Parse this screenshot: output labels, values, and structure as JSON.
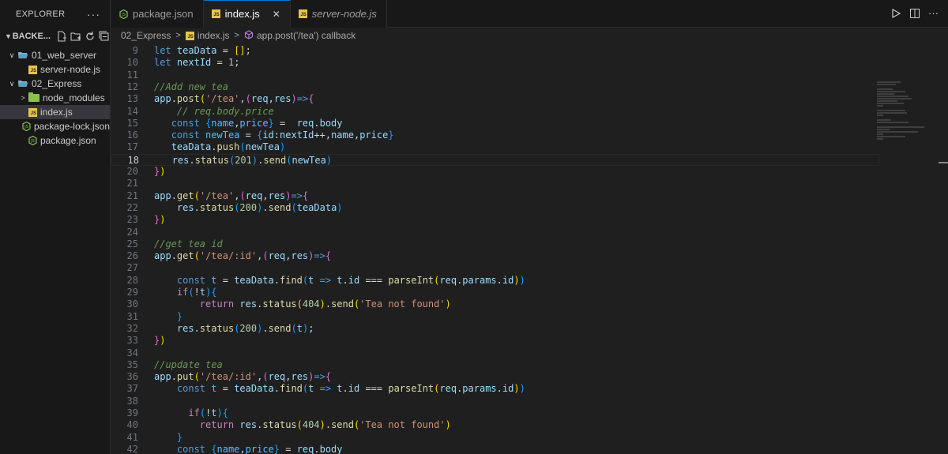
{
  "sidebar": {
    "title": "EXPLORER",
    "root": "BACKE...",
    "items": [
      {
        "label": "01_web_server",
        "kind": "folder-open",
        "indent": 1
      },
      {
        "label": "server-node.js",
        "kind": "js",
        "indent": 2
      },
      {
        "label": "02_Express",
        "kind": "folder-open",
        "indent": 1
      },
      {
        "label": "node_modules",
        "kind": "folder-green",
        "indent": 2
      },
      {
        "label": "index.js",
        "kind": "js",
        "indent": 2,
        "active": true
      },
      {
        "label": "package-lock.json",
        "kind": "json",
        "indent": 2
      },
      {
        "label": "package.json",
        "kind": "json",
        "indent": 2
      }
    ]
  },
  "tabs": [
    {
      "label": "package.json",
      "icon": "json-icon"
    },
    {
      "label": "index.js",
      "icon": "js-icon",
      "active": true
    },
    {
      "label": "server-node.js",
      "icon": "js-icon",
      "italic": true
    }
  ],
  "breadcrumb": [
    "02_Express",
    "index.js",
    "app.post('/tea') callback"
  ],
  "editor": {
    "current_line": 18,
    "lines": [
      {
        "n": 9,
        "t": [
          [
            "kw",
            "let"
          ],
          [
            "pn",
            " "
          ],
          [
            "vr",
            "teaData"
          ],
          [
            "pn",
            " = "
          ],
          [
            "br1",
            "[]"
          ],
          [
            "pn",
            ";"
          ]
        ]
      },
      {
        "n": 10,
        "t": [
          [
            "kw",
            "let"
          ],
          [
            "pn",
            " "
          ],
          [
            "vr",
            "nextId"
          ],
          [
            "pn",
            " = "
          ],
          [
            "nm",
            "1"
          ],
          [
            "pn",
            ";"
          ]
        ]
      },
      {
        "n": 11,
        "t": []
      },
      {
        "n": 12,
        "t": [
          [
            "cm",
            "//Add new tea"
          ]
        ]
      },
      {
        "n": 13,
        "t": [
          [
            "vr",
            "app"
          ],
          [
            "pn",
            "."
          ],
          [
            "fn",
            "post"
          ],
          [
            "br1",
            "("
          ],
          [
            "st",
            "'/tea'"
          ],
          [
            "pn",
            ","
          ],
          [
            "br2",
            "("
          ],
          [
            "vr",
            "req"
          ],
          [
            "pn",
            ","
          ],
          [
            "vr",
            "res"
          ],
          [
            "br2",
            ")"
          ],
          [
            "kw",
            "=>"
          ],
          [
            "br2",
            "{"
          ]
        ]
      },
      {
        "n": 14,
        "t": [
          [
            "pn",
            "    "
          ],
          [
            "cm",
            "// req.body.price"
          ]
        ]
      },
      {
        "n": 15,
        "t": [
          [
            "pn",
            "   "
          ],
          [
            "kw",
            "const"
          ],
          [
            "pn",
            " "
          ],
          [
            "br3",
            "{"
          ],
          [
            "cn",
            "name"
          ],
          [
            "pn",
            ","
          ],
          [
            "cn",
            "price"
          ],
          [
            "br3",
            "}"
          ],
          [
            "pn",
            " =  "
          ],
          [
            "vr",
            "req"
          ],
          [
            "pn",
            "."
          ],
          [
            "vr",
            "body"
          ]
        ]
      },
      {
        "n": 16,
        "t": [
          [
            "pn",
            "   "
          ],
          [
            "kw",
            "const"
          ],
          [
            "pn",
            " "
          ],
          [
            "cn",
            "newTea"
          ],
          [
            "pn",
            " = "
          ],
          [
            "br3",
            "{"
          ],
          [
            "vr",
            "id"
          ],
          [
            "pn",
            ":"
          ],
          [
            "vr",
            "nextId"
          ],
          [
            "pn",
            "++,"
          ],
          [
            "vr",
            "name"
          ],
          [
            "pn",
            ","
          ],
          [
            "vr",
            "price"
          ],
          [
            "br3",
            "}"
          ]
        ]
      },
      {
        "n": 17,
        "t": [
          [
            "pn",
            "   "
          ],
          [
            "vr",
            "teaData"
          ],
          [
            "pn",
            "."
          ],
          [
            "fn",
            "push"
          ],
          [
            "br3",
            "("
          ],
          [
            "vr",
            "newTea"
          ],
          [
            "br3",
            ")"
          ]
        ]
      },
      {
        "n": 18,
        "t": [
          [
            "pn",
            "   "
          ],
          [
            "vr",
            "res"
          ],
          [
            "pn",
            "."
          ],
          [
            "fn",
            "status"
          ],
          [
            "br3",
            "("
          ],
          [
            "nm",
            "201"
          ],
          [
            "br3",
            ")"
          ],
          [
            "pn",
            "."
          ],
          [
            "fn",
            "send"
          ],
          [
            "br3",
            "("
          ],
          [
            "vr",
            "newTea"
          ],
          [
            "br3",
            ")"
          ]
        ]
      },
      {
        "n": 20,
        "t": [
          [
            "br2",
            "}"
          ],
          [
            "br1",
            ")"
          ]
        ]
      },
      {
        "n": 21,
        "t": []
      },
      {
        "n": 21,
        "t": [
          [
            "vr",
            "app"
          ],
          [
            "pn",
            "."
          ],
          [
            "fn",
            "get"
          ],
          [
            "br1",
            "("
          ],
          [
            "st",
            "'/tea'"
          ],
          [
            "pn",
            ","
          ],
          [
            "br2",
            "("
          ],
          [
            "vr",
            "req"
          ],
          [
            "pn",
            ","
          ],
          [
            "vr",
            "res"
          ],
          [
            "br2",
            ")"
          ],
          [
            "kw",
            "=>"
          ],
          [
            "br2",
            "{"
          ]
        ]
      },
      {
        "n": 22,
        "t": [
          [
            "pn",
            "    "
          ],
          [
            "vr",
            "res"
          ],
          [
            "pn",
            "."
          ],
          [
            "fn",
            "status"
          ],
          [
            "br3",
            "("
          ],
          [
            "nm",
            "200"
          ],
          [
            "br3",
            ")"
          ],
          [
            "pn",
            "."
          ],
          [
            "fn",
            "send"
          ],
          [
            "br3",
            "("
          ],
          [
            "vr",
            "teaData"
          ],
          [
            "br3",
            ")"
          ]
        ]
      },
      {
        "n": 23,
        "t": [
          [
            "br2",
            "}"
          ],
          [
            "br1",
            ")"
          ]
        ]
      },
      {
        "n": 24,
        "t": []
      },
      {
        "n": 25,
        "t": [
          [
            "cm",
            "//get tea id"
          ]
        ]
      },
      {
        "n": 26,
        "t": [
          [
            "vr",
            "app"
          ],
          [
            "pn",
            "."
          ],
          [
            "fn",
            "get"
          ],
          [
            "br1",
            "("
          ],
          [
            "st",
            "'/tea/:id'"
          ],
          [
            "pn",
            ","
          ],
          [
            "br2",
            "("
          ],
          [
            "vr",
            "req"
          ],
          [
            "pn",
            ","
          ],
          [
            "vr",
            "res"
          ],
          [
            "br2",
            ")"
          ],
          [
            "kw",
            "=>"
          ],
          [
            "br2",
            "{"
          ]
        ]
      },
      {
        "n": 27,
        "t": []
      },
      {
        "n": 28,
        "t": [
          [
            "pn",
            "    "
          ],
          [
            "kw",
            "const"
          ],
          [
            "pn",
            " "
          ],
          [
            "cn",
            "t"
          ],
          [
            "pn",
            " = "
          ],
          [
            "vr",
            "teaData"
          ],
          [
            "pn",
            "."
          ],
          [
            "fn",
            "find"
          ],
          [
            "br3",
            "("
          ],
          [
            "vr",
            "t"
          ],
          [
            "pn",
            " "
          ],
          [
            "kw",
            "=>"
          ],
          [
            "pn",
            " "
          ],
          [
            "vr",
            "t"
          ],
          [
            "pn",
            "."
          ],
          [
            "vr",
            "id"
          ],
          [
            "pn",
            " === "
          ],
          [
            "fn",
            "parseInt"
          ],
          [
            "br1",
            "("
          ],
          [
            "vr",
            "req"
          ],
          [
            "pn",
            "."
          ],
          [
            "vr",
            "params"
          ],
          [
            "pn",
            "."
          ],
          [
            "vr",
            "id"
          ],
          [
            "br1",
            ")"
          ],
          [
            "br3",
            ")"
          ]
        ]
      },
      {
        "n": 29,
        "t": [
          [
            "pn",
            "    "
          ],
          [
            "kw2",
            "if"
          ],
          [
            "br3",
            "("
          ],
          [
            "pn",
            "!"
          ],
          [
            "vr",
            "t"
          ],
          [
            "br3",
            ")"
          ],
          [
            "br3",
            "{"
          ]
        ]
      },
      {
        "n": 30,
        "t": [
          [
            "pn",
            "        "
          ],
          [
            "kw2",
            "return"
          ],
          [
            "pn",
            " "
          ],
          [
            "vr",
            "res"
          ],
          [
            "pn",
            "."
          ],
          [
            "fn",
            "status"
          ],
          [
            "br1",
            "("
          ],
          [
            "nm",
            "404"
          ],
          [
            "br1",
            ")"
          ],
          [
            "pn",
            "."
          ],
          [
            "fn",
            "send"
          ],
          [
            "br1",
            "("
          ],
          [
            "st",
            "'Tea not found'"
          ],
          [
            "br1",
            ")"
          ]
        ]
      },
      {
        "n": 31,
        "t": [
          [
            "pn",
            "    "
          ],
          [
            "br3",
            "}"
          ]
        ]
      },
      {
        "n": 32,
        "t": [
          [
            "pn",
            "    "
          ],
          [
            "vr",
            "res"
          ],
          [
            "pn",
            "."
          ],
          [
            "fn",
            "status"
          ],
          [
            "br3",
            "("
          ],
          [
            "nm",
            "200"
          ],
          [
            "br3",
            ")"
          ],
          [
            "pn",
            "."
          ],
          [
            "fn",
            "send"
          ],
          [
            "br3",
            "("
          ],
          [
            "vr",
            "t"
          ],
          [
            "br3",
            ")"
          ],
          [
            "pn",
            ";"
          ]
        ]
      },
      {
        "n": 33,
        "t": [
          [
            "br2",
            "}"
          ],
          [
            "br1",
            ")"
          ]
        ]
      },
      {
        "n": 34,
        "t": []
      },
      {
        "n": 35,
        "t": [
          [
            "cm",
            "//update tea"
          ]
        ]
      },
      {
        "n": 36,
        "t": [
          [
            "vr",
            "app"
          ],
          [
            "pn",
            "."
          ],
          [
            "fn",
            "put"
          ],
          [
            "br1",
            "("
          ],
          [
            "st",
            "'/tea/:id'"
          ],
          [
            "pn",
            ","
          ],
          [
            "br2",
            "("
          ],
          [
            "vr",
            "req"
          ],
          [
            "pn",
            ","
          ],
          [
            "vr",
            "res"
          ],
          [
            "br2",
            ")"
          ],
          [
            "kw",
            "=>"
          ],
          [
            "br2",
            "{"
          ]
        ]
      },
      {
        "n": 37,
        "t": [
          [
            "pn",
            "    "
          ],
          [
            "kw",
            "const"
          ],
          [
            "pn",
            " "
          ],
          [
            "cn",
            "t"
          ],
          [
            "pn",
            " = "
          ],
          [
            "vr",
            "teaData"
          ],
          [
            "pn",
            "."
          ],
          [
            "fn",
            "find"
          ],
          [
            "br3",
            "("
          ],
          [
            "vr",
            "t"
          ],
          [
            "pn",
            " "
          ],
          [
            "kw",
            "=>"
          ],
          [
            "pn",
            " "
          ],
          [
            "vr",
            "t"
          ],
          [
            "pn",
            "."
          ],
          [
            "vr",
            "id"
          ],
          [
            "pn",
            " === "
          ],
          [
            "fn",
            "parseInt"
          ],
          [
            "br1",
            "("
          ],
          [
            "vr",
            "req"
          ],
          [
            "pn",
            "."
          ],
          [
            "vr",
            "params"
          ],
          [
            "pn",
            "."
          ],
          [
            "vr",
            "id"
          ],
          [
            "br1",
            ")"
          ],
          [
            "br3",
            ")"
          ]
        ]
      },
      {
        "n": 38,
        "t": []
      },
      {
        "n": 39,
        "t": [
          [
            "pn",
            "      "
          ],
          [
            "kw2",
            "if"
          ],
          [
            "br3",
            "("
          ],
          [
            "pn",
            "!"
          ],
          [
            "vr",
            "t"
          ],
          [
            "br3",
            ")"
          ],
          [
            "br3",
            "{"
          ]
        ]
      },
      {
        "n": 40,
        "t": [
          [
            "pn",
            "        "
          ],
          [
            "kw2",
            "return"
          ],
          [
            "pn",
            " "
          ],
          [
            "vr",
            "res"
          ],
          [
            "pn",
            "."
          ],
          [
            "fn",
            "status"
          ],
          [
            "br1",
            "("
          ],
          [
            "nm",
            "404"
          ],
          [
            "br1",
            ")"
          ],
          [
            "pn",
            "."
          ],
          [
            "fn",
            "send"
          ],
          [
            "br1",
            "("
          ],
          [
            "st",
            "'Tea not found'"
          ],
          [
            "br1",
            ")"
          ]
        ]
      },
      {
        "n": 41,
        "t": [
          [
            "pn",
            "    "
          ],
          [
            "br3",
            "}"
          ]
        ]
      },
      {
        "n": 42,
        "t": [
          [
            "pn",
            "    "
          ],
          [
            "kw",
            "const"
          ],
          [
            "pn",
            " "
          ],
          [
            "br3",
            "{"
          ],
          [
            "cn",
            "name"
          ],
          [
            "pn",
            ","
          ],
          [
            "cn",
            "price"
          ],
          [
            "br3",
            "}"
          ],
          [
            "pn",
            " = "
          ],
          [
            "vr",
            "req"
          ],
          [
            "pn",
            "."
          ],
          [
            "vr",
            "body"
          ]
        ]
      }
    ]
  }
}
